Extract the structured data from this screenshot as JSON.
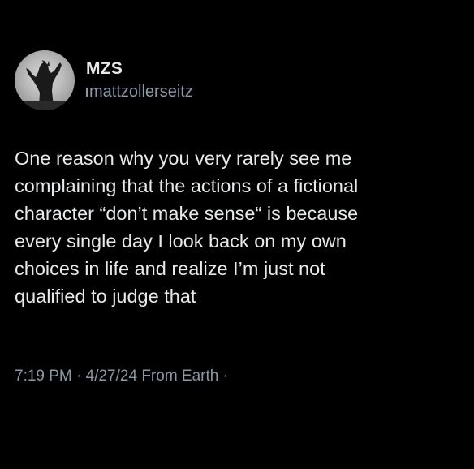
{
  "tweet": {
    "display_name": "MZS",
    "handle": "mattzollerseitz",
    "text": "One reason why you very rarely see me\ncomplaining that the actions of a fictional\ncharacter “don’t make sense“ is because\nevery single day I look back on my own\nchoices in life and realize I’m just not\nqualified to judge that",
    "timestamp": "7:19 PM · 4/27/24 From Earth ·",
    "avatar_icon": "godzilla-avatar"
  }
}
